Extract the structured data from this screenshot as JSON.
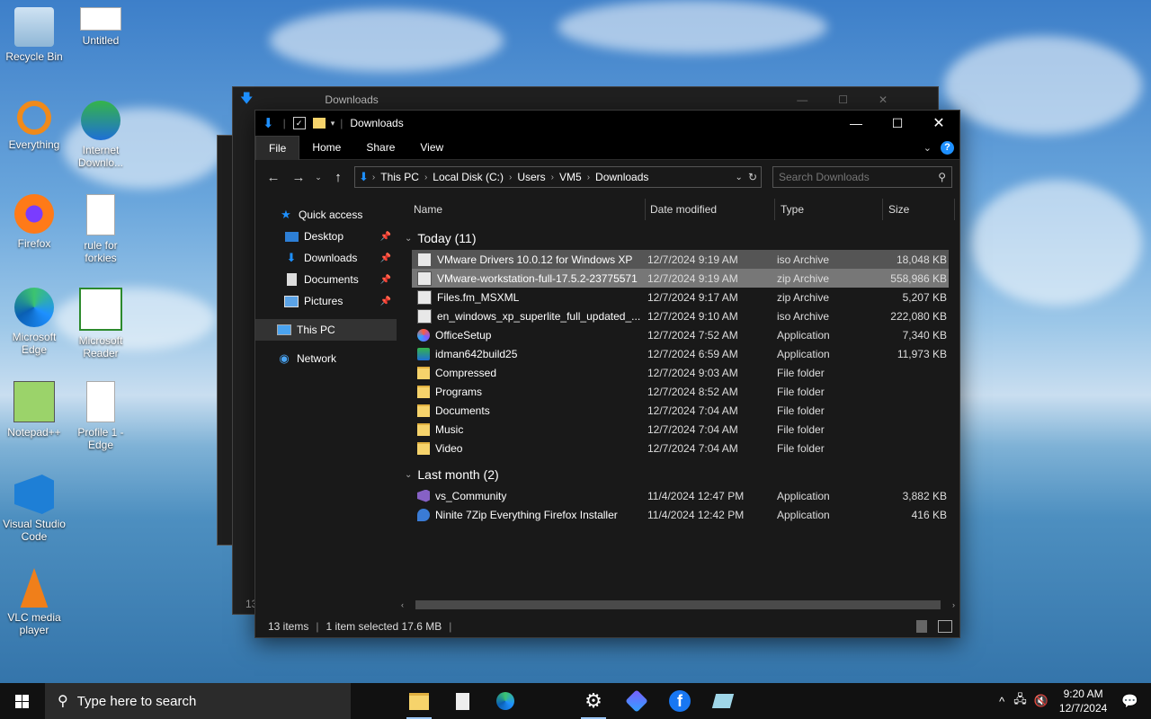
{
  "desktop": {
    "icons": [
      {
        "label": "Recycle Bin"
      },
      {
        "label": "Untitled"
      },
      {
        "label": "Everything"
      },
      {
        "label": "Internet Downlo..."
      },
      {
        "label": "Firefox"
      },
      {
        "label": "rule for forkies"
      },
      {
        "label": "Microsoft Edge"
      },
      {
        "label": "Microsoft Reader"
      },
      {
        "label": "Notepad++"
      },
      {
        "label": "Profile 1 - Edge"
      },
      {
        "label": "Visual Studio Code"
      },
      {
        "label": "VLC media player"
      }
    ]
  },
  "bg_window": {
    "title": "Downloads",
    "status": "13"
  },
  "window": {
    "title": "Downloads",
    "ribbon_tabs": [
      "File",
      "Home",
      "Share",
      "View"
    ],
    "breadcrumb": [
      "This PC",
      "Local Disk (C:)",
      "Users",
      "VM5",
      "Downloads"
    ],
    "search_placeholder": "Search Downloads",
    "nav": {
      "quick_access": "Quick access",
      "pinned": [
        "Desktop",
        "Downloads",
        "Documents",
        "Pictures"
      ],
      "this_pc": "This PC",
      "network": "Network"
    },
    "columns": [
      "Name",
      "Date modified",
      "Type",
      "Size"
    ],
    "groups": [
      {
        "label": "Today (11)",
        "rows": [
          {
            "name": "VMware Drivers 10.0.12 for Windows XP",
            "date": "12/7/2024 9:19 AM",
            "type": "iso Archive",
            "size": "18,048 KB",
            "icon": "iso-icon",
            "state": "hover"
          },
          {
            "name": "VMware-workstation-full-17.5.2-23775571",
            "date": "12/7/2024 9:19 AM",
            "type": "zip Archive",
            "size": "558,986 KB",
            "icon": "zip-icon",
            "state": "selected"
          },
          {
            "name": "Files.fm_MSXML",
            "date": "12/7/2024 9:17 AM",
            "type": "zip Archive",
            "size": "5,207 KB",
            "icon": "zip-icon",
            "state": ""
          },
          {
            "name": "en_windows_xp_superlite_full_updated_...",
            "date": "12/7/2024 9:10 AM",
            "type": "iso Archive",
            "size": "222,080 KB",
            "icon": "iso-icon",
            "state": ""
          },
          {
            "name": "OfficeSetup",
            "date": "12/7/2024 7:52 AM",
            "type": "Application",
            "size": "7,340 KB",
            "icon": "office-icon",
            "state": ""
          },
          {
            "name": "idman642build25",
            "date": "12/7/2024 6:59 AM",
            "type": "Application",
            "size": "11,973 KB",
            "icon": "installer-icon",
            "state": ""
          },
          {
            "name": "Compressed",
            "date": "12/7/2024 9:03 AM",
            "type": "File folder",
            "size": "",
            "icon": "folder-icon",
            "state": ""
          },
          {
            "name": "Programs",
            "date": "12/7/2024 8:52 AM",
            "type": "File folder",
            "size": "",
            "icon": "folder-icon",
            "state": ""
          },
          {
            "name": "Documents",
            "date": "12/7/2024 7:04 AM",
            "type": "File folder",
            "size": "",
            "icon": "folder-icon",
            "state": ""
          },
          {
            "name": "Music",
            "date": "12/7/2024 7:04 AM",
            "type": "File folder",
            "size": "",
            "icon": "folder-icon",
            "state": ""
          },
          {
            "name": "Video",
            "date": "12/7/2024 7:04 AM",
            "type": "File folder",
            "size": "",
            "icon": "folder-icon",
            "state": ""
          }
        ]
      },
      {
        "label": "Last month (2)",
        "rows": [
          {
            "name": "vs_Community",
            "date": "11/4/2024 12:47 PM",
            "type": "Application",
            "size": "3,882 KB",
            "icon": "vs-icon",
            "state": ""
          },
          {
            "name": "Ninite 7Zip Everything Firefox Installer",
            "date": "11/4/2024 12:42 PM",
            "type": "Application",
            "size": "416 KB",
            "icon": "ninite-icon",
            "state": ""
          }
        ]
      }
    ],
    "status": {
      "items": "13 items",
      "selected": "1 item selected  17.6 MB"
    }
  },
  "taskbar": {
    "search_placeholder": "Type here to search",
    "time": "9:20 AM",
    "date": "12/7/2024"
  },
  "colors": {
    "accent": "#1e90ff",
    "folder": "#f6d36b",
    "selected_row": "#777777"
  }
}
